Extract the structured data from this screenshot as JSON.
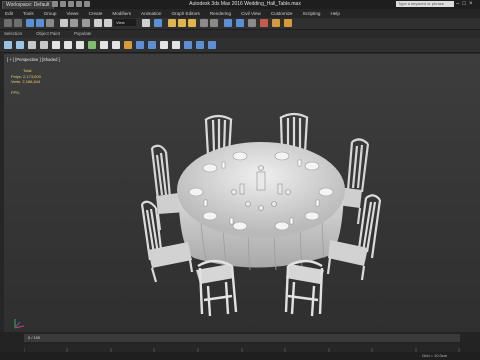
{
  "app": {
    "workspace_label": "Workspace: Default",
    "title": "Autodesk 3ds Max 2016      Wedding_Hall_Table.max",
    "search_placeholder": "Type a keyword or phrase"
  },
  "menu": [
    "Edit",
    "Tools",
    "Group",
    "Views",
    "Create",
    "Modifiers",
    "Animation",
    "Graph Editors",
    "Rendering",
    "Civil View",
    "Customize",
    "Scripting",
    "Help"
  ],
  "tabs": [
    "Selection",
    "Object Paint",
    "Populate"
  ],
  "toolbar": {
    "selection_filter": "All",
    "view_dropdown": "View"
  },
  "viewport": {
    "label": "[ + ] [Perspective ] [Shaded ]",
    "stats": {
      "header": "Total",
      "polys_label": "Polys:",
      "polys_value": "2,173,000",
      "verts_label": "Verts:",
      "verts_value": "2,186,844",
      "fps_label": "FPS:"
    }
  },
  "timeline": {
    "frame_counter": "0 / 100"
  },
  "status": {
    "grid": "Grid = 10.0cm"
  },
  "colors": {
    "viewport_bg": "#383838",
    "stats_text": "#e6d36a",
    "model": "#d8d8d8"
  },
  "icons": [
    "workspace-dropdown-icon",
    "undo-icon",
    "redo-icon",
    "select-icon",
    "move-icon",
    "rotate-icon",
    "scale-icon",
    "snap-icon",
    "render-icon",
    "axis-gizmo-icon"
  ]
}
